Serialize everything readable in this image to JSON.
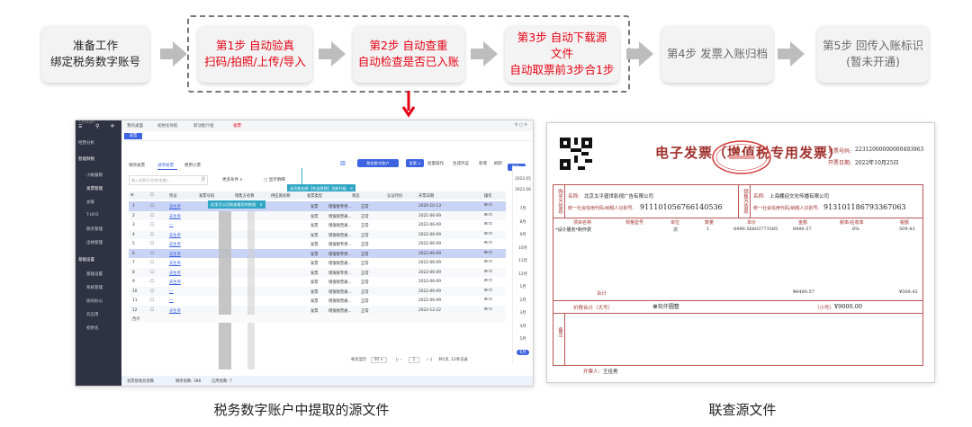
{
  "flow": {
    "steps": [
      {
        "line1": "准备工作",
        "line2": "绑定税务数字账号",
        "style": "dark"
      },
      {
        "line1": "第1步 自动验真",
        "line2": "扫码/拍照/上传/导入",
        "style": "red"
      },
      {
        "line1": "第2步 自动查重",
        "line2": "自动检查是否已入账",
        "style": "red"
      },
      {
        "line1": "第3步 自动下载源文件",
        "line2": "自动取票前3步合1步",
        "style": "red"
      },
      {
        "line1": "第4步 发票入账归档",
        "line2": "",
        "style": "gray"
      },
      {
        "line1": "第5步 回传入账标识",
        "line2": "(暂未开通)",
        "style": "gray"
      }
    ]
  },
  "captions": {
    "left": "税务数字账户中提取的源文件",
    "right": "联查源文件"
  },
  "app": {
    "top_label": "Changan",
    "sidebar": [
      "经营分析",
      "智能财税",
      "小帐报销",
      "发票管理",
      "总账",
      "T-UFO",
      "税务管理",
      "出纳管理",
      "基础设置",
      "基础设置",
      "系统管理",
      "协同办公",
      "云应用",
      "初始化"
    ],
    "top_tabs": [
      "我的桌面",
      "初始化导航",
      "新功能介绍",
      "发票"
    ],
    "page_tab": "发票",
    "sub_tabs": [
      "销项发票",
      "进项发票",
      "费用小票"
    ],
    "search_placeholder": "输入发票号/名称/金额/…",
    "filter_label": "更多条件",
    "show_detail": "显示明细",
    "tax_account_btn": "税务数字账户",
    "toolbar": [
      "批量操作",
      "生成凭证",
      "新增",
      "刷新"
    ],
    "tip_function": "该功能由原【先益财税】功能升级",
    "tip_switch": "这里可以切换查看您的数据",
    "columns": [
      "凭证",
      "发票号码",
      "销售方名称",
      "供应商名称",
      "发票类型",
      "发票种类",
      "状态",
      "认证月份",
      "开票日期",
      "操作"
    ],
    "rows": [
      {
        "no": "1",
        "voucher": "去生单",
        "type": "发票",
        "kind": "增值税专用...",
        "status": "正常",
        "date": "2020-10-13"
      },
      {
        "no": "2",
        "voucher": "去生单",
        "type": "发票",
        "kind": "增值税普通...",
        "status": "正常",
        "date": "2021-06-09"
      },
      {
        "no": "3",
        "voucher": "---",
        "type": "发票",
        "kind": "增值税普通...",
        "status": "正常",
        "date": "2022-06-09"
      },
      {
        "no": "4",
        "voucher": "去生单",
        "type": "发票",
        "kind": "增值税普通...",
        "status": "正常",
        "date": "2022-06-09"
      },
      {
        "no": "5",
        "voucher": "去生单",
        "type": "发票",
        "kind": "增值税专用...",
        "status": "正常",
        "date": "2022-06-09"
      },
      {
        "no": "6",
        "voucher": "去生单",
        "type": "发票",
        "kind": "增值税专用...",
        "status": "正常",
        "date": "2022-06-09"
      },
      {
        "no": "7",
        "voucher": "去生单",
        "type": "发票",
        "kind": "增值税普通...",
        "status": "正常",
        "date": "2022-06-09"
      },
      {
        "no": "8",
        "voucher": "去生单",
        "type": "发票",
        "kind": "增值税专用...",
        "status": "正常",
        "date": "2022-06-09"
      },
      {
        "no": "9",
        "voucher": "去生单",
        "type": "发票",
        "kind": "增值税普通...",
        "status": "正常",
        "date": "2022-06-09"
      },
      {
        "no": "10",
        "voucher": "---",
        "type": "发票",
        "kind": "增值税普通...",
        "status": "正常",
        "date": "2022-06-09"
      },
      {
        "no": "11",
        "voucher": "---",
        "type": "发票",
        "kind": "增值税普通...",
        "status": "正常",
        "date": "2022-06-09"
      },
      {
        "no": "12",
        "voucher": "去生单",
        "type": "发票",
        "kind": "增值税普通...",
        "status": "正常",
        "date": "2022-12-22"
      }
    ],
    "total_label": "合计",
    "year_list": [
      "2023.05",
      "2023.06"
    ],
    "months": [
      "7月",
      "8月",
      "9月",
      "10月",
      "11月",
      "12月",
      "1月",
      "2月",
      "3月",
      "4月",
      "5月",
      "6月"
    ],
    "pagination": {
      "per_page_label": "每页显示",
      "per_page": "50",
      "page": "1",
      "total": "共1页, 12条记录"
    },
    "footer": {
      "sum_label": "发票接收总张数",
      "total_count_label": "剩余张数: 388",
      "used_label": "已用张数: 7"
    }
  },
  "invoice": {
    "title": "电子发票（增值税专用发票）",
    "invoice_no_label": "发票号码:",
    "invoice_no": "22312000000000493963",
    "date_label": "开票日期:",
    "date": "2022年10月25日",
    "buyer_label": "购买方信息",
    "seller_label": "销售方信息",
    "buyer_name_label": "名称:",
    "buyer_name": "北京太平盛世影视广告有限公司",
    "buyer_tax_label": "统一社会信用代码/纳税人识别号:",
    "buyer_tax": "911101056766140536",
    "seller_name_label": "名称:",
    "seller_name": "上海棚迎文化传播有限公司",
    "seller_tax_label": "统一社会信用代码/纳税人识别号:",
    "seller_tax": "913101186793367063",
    "item_headers": [
      "项目名称",
      "规格型号",
      "单位",
      "数量",
      "单价",
      "金额",
      "税率/征收率",
      "税额"
    ],
    "item": {
      "name": "*设计服务*制作费",
      "unit": "次",
      "qty": "1",
      "price": "8490.56603773585",
      "amount": "8490.57",
      "rate": "6%",
      "tax": "509.43"
    },
    "total_label": "合计",
    "total_amount": "¥8490.57",
    "total_tax": "¥509.43",
    "grand_label": "价税合计（大写）",
    "grand_upper": "玖仟圆整",
    "grand_lower_label": "（小写）",
    "grand_lower": "¥9000.00",
    "remark_label": "备注",
    "issuer_label": "开票人:",
    "issuer": "王佳男"
  }
}
